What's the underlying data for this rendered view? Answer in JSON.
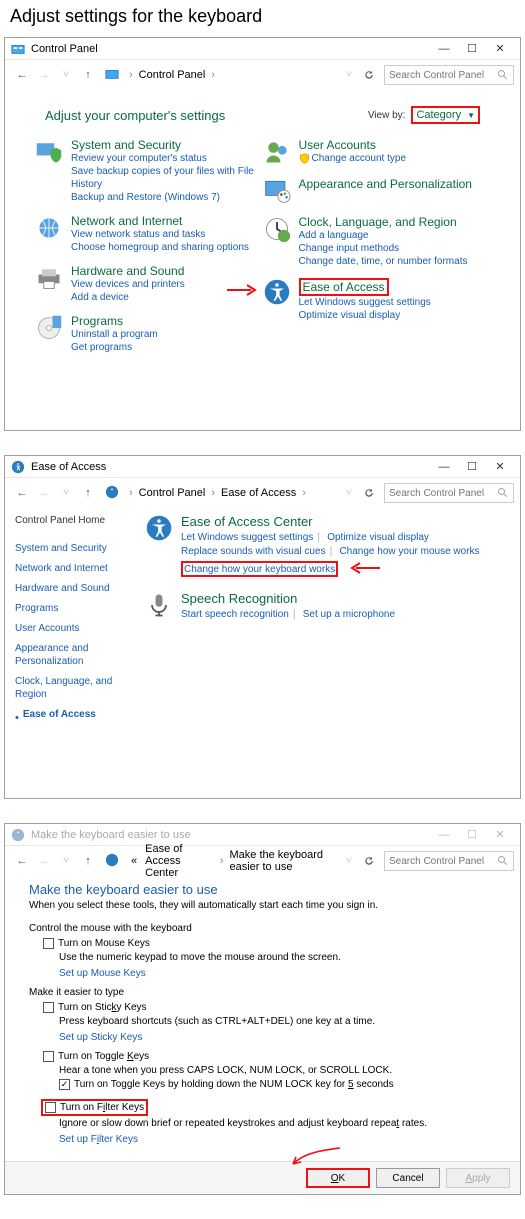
{
  "page_title": "Adjust settings for the keyboard",
  "win1": {
    "title": "Control Panel",
    "search_placeholder": "Search Control Panel",
    "crumbs": [
      "Control Panel"
    ],
    "adjust_heading": "Adjust your computer's settings",
    "view_by_label": "View by:",
    "view_by_value": "Category",
    "left": [
      {
        "cat": "System and Security",
        "links": [
          "Review your computer's status",
          "Save backup copies of your files with File History",
          "Backup and Restore (Windows 7)"
        ]
      },
      {
        "cat": "Network and Internet",
        "links": [
          "View network status and tasks",
          "Choose homegroup and sharing options"
        ]
      },
      {
        "cat": "Hardware and Sound",
        "links": [
          "View devices and printers",
          "Add a device"
        ]
      },
      {
        "cat": "Programs",
        "links": [
          "Uninstall a program",
          "Get programs"
        ]
      }
    ],
    "right": [
      {
        "cat": "User Accounts",
        "links": [
          "Change account type"
        ]
      },
      {
        "cat": "Appearance and Personalization",
        "links": []
      },
      {
        "cat": "Clock, Language, and Region",
        "links": [
          "Add a language",
          "Change input methods",
          "Change date, time, or number formats"
        ]
      },
      {
        "cat": "Ease of Access",
        "links": [
          "Let Windows suggest settings",
          "Optimize visual display"
        ],
        "highlight": true
      }
    ]
  },
  "win2": {
    "title": "Ease of Access",
    "crumbs": [
      "Control Panel",
      "Ease of Access"
    ],
    "search_placeholder": "Search Control Panel",
    "side": [
      {
        "label": "Control Panel Home",
        "plain": true
      },
      {
        "label": "System and Security"
      },
      {
        "label": "Network and Internet"
      },
      {
        "label": "Hardware and Sound"
      },
      {
        "label": "Programs"
      },
      {
        "label": "User Accounts"
      },
      {
        "label": "Appearance and Personalization"
      },
      {
        "label": "Clock, Language, and Region"
      },
      {
        "label": "Ease of Access",
        "bold": true,
        "bullet": true
      }
    ],
    "eac": {
      "head": "Ease of Access Center",
      "row1": [
        "Let Windows suggest settings",
        "Optimize visual display"
      ],
      "row2": [
        "Replace sounds with visual cues",
        "Change how your mouse works"
      ],
      "kbd": "Change how your keyboard works"
    },
    "speech": {
      "head": "Speech Recognition",
      "links": [
        "Start speech recognition",
        "Set up a microphone"
      ]
    }
  },
  "win3": {
    "title": "Make the keyboard easier to use",
    "crumbs_prefix": "«",
    "crumbs": [
      "Ease of Access Center",
      "Make the keyboard easier to use"
    ],
    "search_placeholder": "Search Control Panel",
    "head": "Make the keyboard easier to use",
    "sub": "When you select these tools, they will automatically start each time you sign in.",
    "sec1_head": "Control the mouse with the keyboard",
    "mouse_keys": {
      "label": "Turn on Mouse Keys",
      "checked": false
    },
    "mouse_desc": "Use the numeric keypad to move the mouse around the screen.",
    "mouse_link": "Set up Mouse Keys",
    "sec2_head": "Make it easier to type",
    "sticky": {
      "label_pre": "Turn on Stic",
      "letter": "k",
      "label_post": "y Keys",
      "checked": false
    },
    "sticky_desc": "Press keyboard shortcuts (such as CTRL+ALT+DEL) one key at a time.",
    "sticky_link": "Set up Sticky Keys",
    "toggle": {
      "label_pre": "Turn on Toggle ",
      "letter": "K",
      "label_post": "eys",
      "checked": false
    },
    "toggle_desc": "Hear a tone when you press CAPS LOCK, NUM LOCK, or SCROLL LOCK.",
    "toggle_hold": {
      "pre": "Turn on Toggle Keys by holding down the NUM LOCK key for ",
      "letter": "5",
      "post": " seconds",
      "checked": true
    },
    "filter": {
      "label_pre": "Turn on F",
      "letter": "i",
      "label_post": "lter Keys",
      "checked": false
    },
    "filter_desc": {
      "pre": "Ignore or slow down brief or repeated keystrokes and adjust keyboard repea",
      "letter": "t",
      "post": " rates."
    },
    "filter_link": {
      "pre": "Set up F",
      "letter": "i",
      "post": "lter Keys"
    },
    "buttons": {
      "ok": "OK",
      "cancel": "Cancel",
      "apply": "Apply"
    }
  }
}
